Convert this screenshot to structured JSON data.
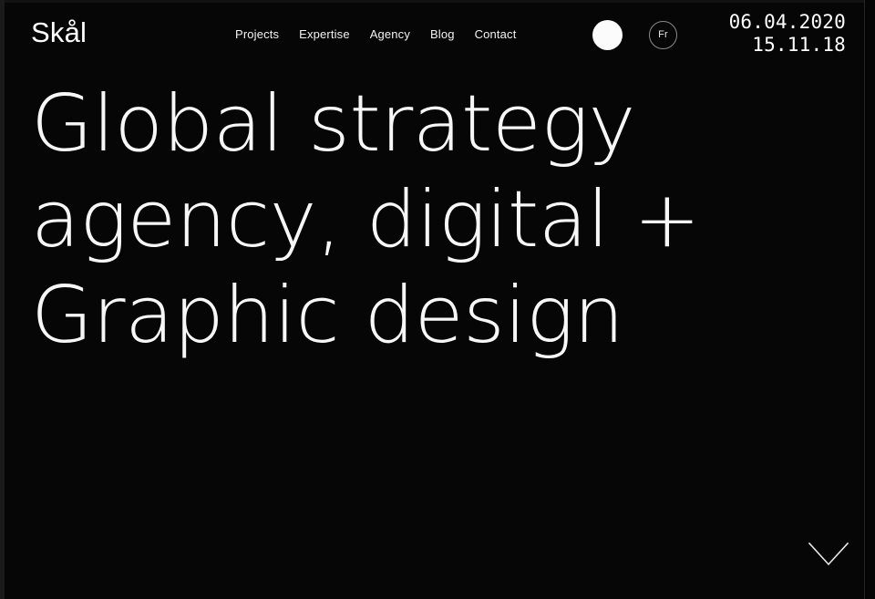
{
  "site": {
    "background_color": "#060606",
    "text_color": "#ffffff"
  },
  "header": {
    "logo": "Skål",
    "nav": [
      {
        "label": "Projects"
      },
      {
        "label": "Expertise"
      },
      {
        "label": "Agency"
      },
      {
        "label": "Blog"
      },
      {
        "label": "Contact"
      }
    ],
    "indicator_dot": {
      "icon": "filled-circle-icon",
      "color": "#fbfbfb"
    },
    "language_toggle": {
      "label": "Fr",
      "icon": "circle-outline-icon"
    },
    "clock": {
      "date": "06.04.2020",
      "time": "15.11.18"
    }
  },
  "hero": {
    "lines": [
      "Global strategy",
      "agency, digital +",
      "Graphic design"
    ]
  },
  "footer": {
    "scroll_cue": {
      "icon": "chevron-down-icon"
    }
  }
}
